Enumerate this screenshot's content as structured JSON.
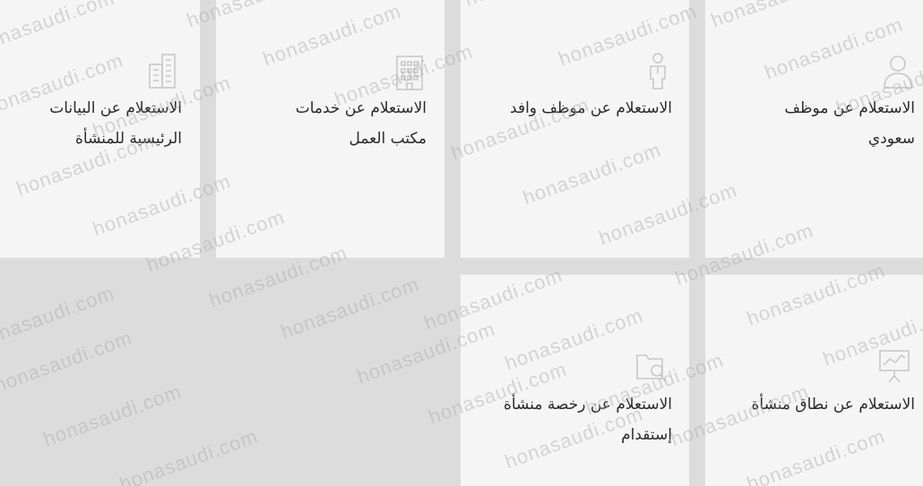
{
  "tiles": [
    {
      "label": "الاستعلام عن موظف\nسعودي",
      "icon": "person-icon"
    },
    {
      "label": "الاستعلام عن موظف وافد",
      "icon": "worker-icon"
    },
    {
      "label": "الاستعلام عن خدمات\nمكتب العمل",
      "icon": "office-building-icon"
    },
    {
      "label": "الاستعلام عن البيانات\nالرئيسية للمنشأة",
      "icon": "buildings-icon"
    },
    {
      "label": "الاستعلام عن نطاق منشأة",
      "icon": "presentation-board-icon"
    },
    {
      "label": "الاستعلام عن رخصة منشأة\nإستقدام",
      "icon": "folder-search-icon"
    }
  ],
  "watermark": "honasaudi.com",
  "colors": {
    "background": "#dcdcdc",
    "tile": "#f5f5f5",
    "text": "#2b2b2b",
    "icon": "#c8c8c8"
  }
}
